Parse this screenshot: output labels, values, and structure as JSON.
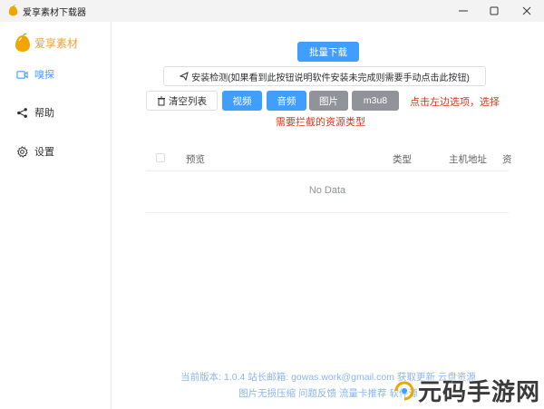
{
  "window": {
    "title": "爱享素材下载器"
  },
  "sidebar": {
    "brand": "爱享素材",
    "items": [
      {
        "label": "嗅探",
        "icon": "video-icon"
      },
      {
        "label": "帮助",
        "icon": "share-icon"
      },
      {
        "label": "设置",
        "icon": "gear-icon"
      }
    ]
  },
  "toolbar": {
    "batch_download": "批量下载",
    "install_check": "安装检测(如果看到此按钮说明软件安装未完成则需要手动点击此按钮)",
    "clear_list": "清空列表",
    "filters": [
      "视频",
      "音频",
      "图片",
      "m3u8"
    ],
    "hint_line1": "点击左边选项，选择",
    "hint_line2": "需要拦截的资源类型"
  },
  "table": {
    "columns": [
      "预览",
      "类型",
      "主机地址",
      "资"
    ],
    "empty_text": "No Data"
  },
  "footer": {
    "line1": "当前版本: 1.0.4  站长邮箱: gowas.work@gmail.com  获取更新  云盘资源",
    "line2": "图片无损压缩  问题反馈  流量卡推荐  软件源"
  },
  "watermark": {
    "text": "元码手游网"
  },
  "colors": {
    "primary": "#409eff",
    "gray": "#909399",
    "hint": "#d9381e",
    "brand": "#e6a23c"
  }
}
